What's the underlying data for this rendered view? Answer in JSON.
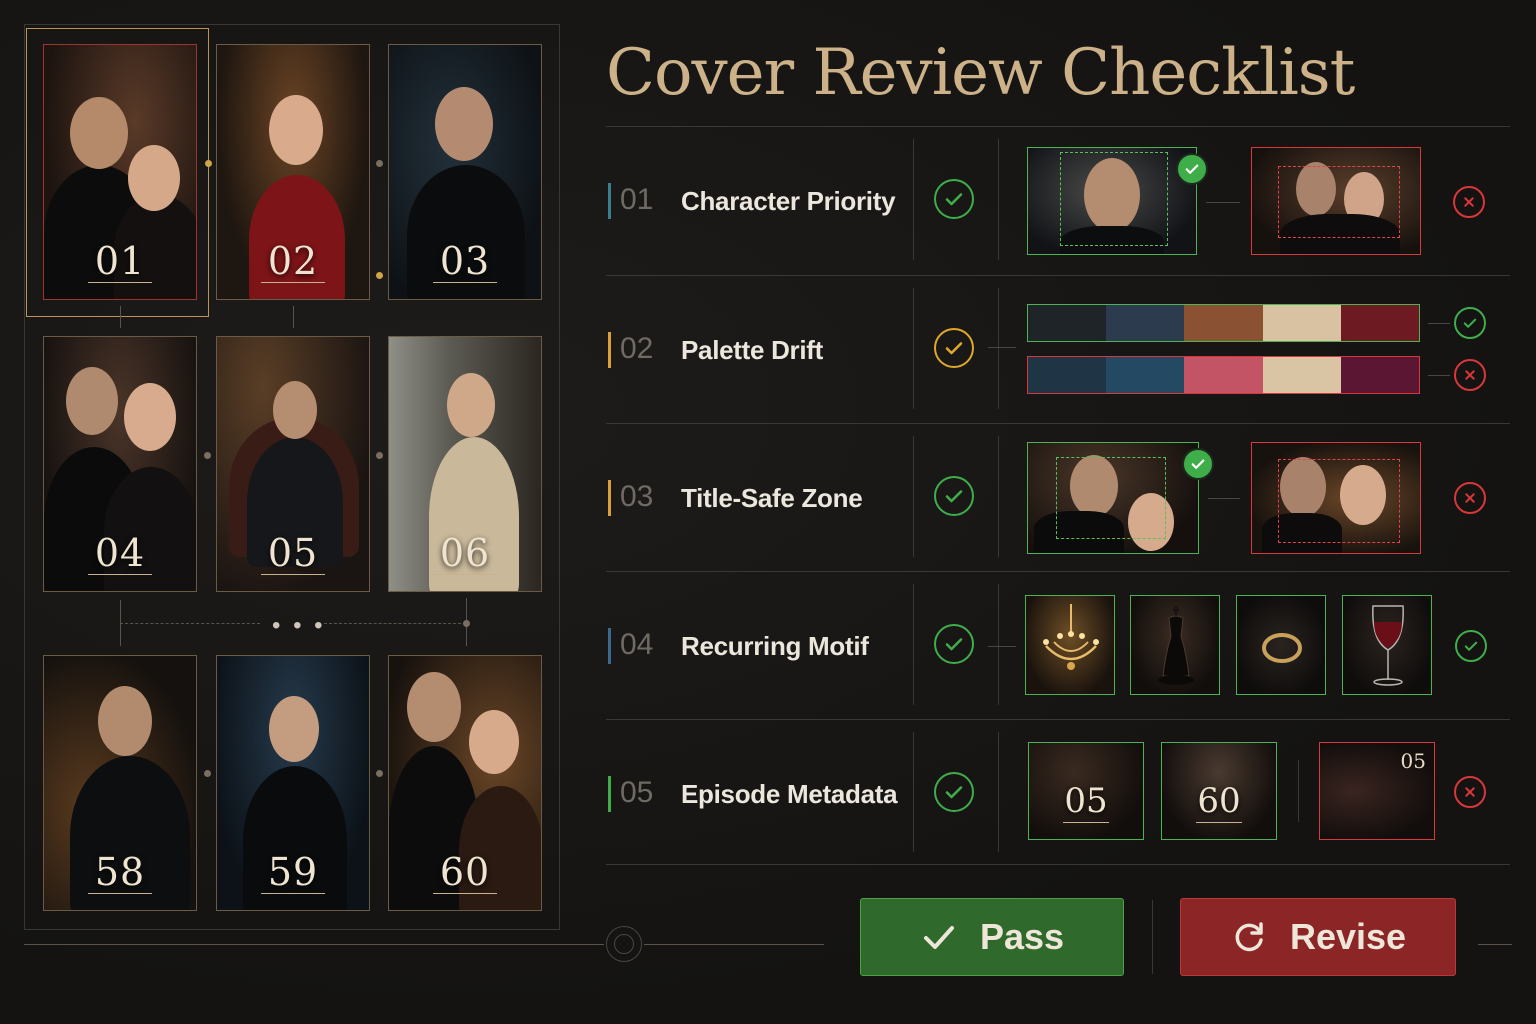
{
  "title": "Cover Review Checklist",
  "grid": {
    "covers": [
      "01",
      "02",
      "03",
      "04",
      "05",
      "06",
      "58",
      "59",
      "60"
    ],
    "ellipsis": "• • •",
    "selected": "01"
  },
  "checklist": [
    {
      "num": "01",
      "label": "Character Priority",
      "status": "pass",
      "accent": "#3b7f8c"
    },
    {
      "num": "02",
      "label": "Palette Drift",
      "status": "warning",
      "accent": "#d9a238"
    },
    {
      "num": "03",
      "label": "Title-Safe Zone",
      "status": "pass",
      "accent": "#d9a238"
    },
    {
      "num": "04",
      "label": "Recurring Motif",
      "status": "pass",
      "accent": "#3b6b8c"
    },
    {
      "num": "05",
      "label": "Episode Metadata",
      "status": "pass",
      "accent": "#3fae4a"
    }
  ],
  "palettes": {
    "good": [
      "#1e2428",
      "#2c3c4e",
      "#8a5232",
      "#d8c2a2",
      "#6e1a22"
    ],
    "bad": [
      "#1f3444",
      "#244a63",
      "#c25466",
      "#d9c4a3",
      "#5a1632"
    ]
  },
  "motifs": [
    "chandelier-icon",
    "chess-king-icon",
    "ring-icon",
    "wine-glass-icon"
  ],
  "episode_meta": {
    "good": [
      "05",
      "60"
    ],
    "bad": "05"
  },
  "actions": {
    "pass": "Pass",
    "revise": "Revise"
  },
  "colors": {
    "pass": "#3fae4a",
    "fail": "#d9373a",
    "warn": "#e0a82a",
    "accent": "#ccb189"
  }
}
